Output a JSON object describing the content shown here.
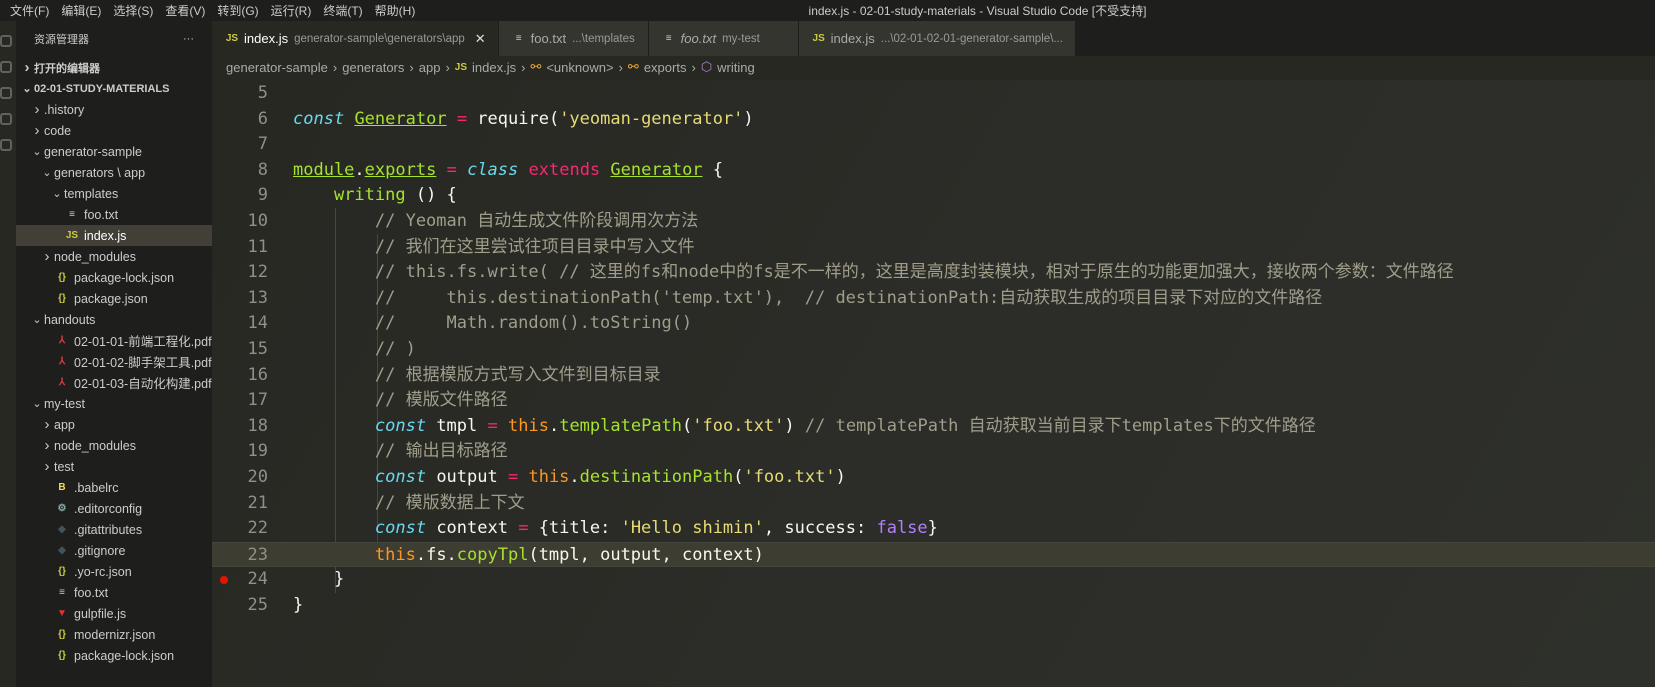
{
  "title": {
    "menus": [
      "文件(F)",
      "编辑(E)",
      "选择(S)",
      "查看(V)",
      "转到(G)",
      "运行(R)",
      "终端(T)",
      "帮助(H)"
    ],
    "window_title": "index.js - 02-01-study-materials - Visual Studio Code [不受支持]"
  },
  "sidebar": {
    "header": "资源管理器",
    "more": "···",
    "rows": [
      {
        "label": "打开的编辑器",
        "depth": 0,
        "chev": "›",
        "sec": true
      },
      {
        "label": "02-01-STUDY-MATERIALS",
        "depth": 0,
        "chev": "⌄",
        "sec": true
      },
      {
        "label": ".history",
        "depth": 1,
        "chev": "›"
      },
      {
        "label": "code",
        "depth": 1,
        "chev": "›"
      },
      {
        "label": "generator-sample",
        "depth": 1,
        "chev": "⌄"
      },
      {
        "label": "generators \\ app",
        "depth": 2,
        "chev": "⌄"
      },
      {
        "label": "templates",
        "depth": 3,
        "chev": "⌄"
      },
      {
        "label": "foo.txt",
        "depth": 3,
        "icon": "txt"
      },
      {
        "label": "index.js",
        "depth": 3,
        "icon": "js",
        "sel": true
      },
      {
        "label": "node_modules",
        "depth": 2,
        "chev": "›"
      },
      {
        "label": "package-lock.json",
        "depth": 2,
        "icon": "json"
      },
      {
        "label": "package.json",
        "depth": 2,
        "icon": "json"
      },
      {
        "label": "handouts",
        "depth": 1,
        "chev": "⌄"
      },
      {
        "label": "02-01-01-前端工程化.pdf",
        "depth": 2,
        "icon": "pdf"
      },
      {
        "label": "02-01-02-脚手架工具.pdf",
        "depth": 2,
        "icon": "pdf"
      },
      {
        "label": "02-01-03-自动化构建.pdf",
        "depth": 2,
        "icon": "pdf"
      },
      {
        "label": "my-test",
        "depth": 1,
        "chev": "⌄"
      },
      {
        "label": "app",
        "depth": 2,
        "chev": "›"
      },
      {
        "label": "node_modules",
        "depth": 2,
        "chev": "›"
      },
      {
        "label": "test",
        "depth": 2,
        "chev": "›"
      },
      {
        "label": ".babelrc",
        "depth": 2,
        "icon": "babel"
      },
      {
        "label": ".editorconfig",
        "depth": 2,
        "icon": "gear"
      },
      {
        "label": ".gitattributes",
        "depth": 2,
        "icon": "git"
      },
      {
        "label": ".gitignore",
        "depth": 2,
        "icon": "git"
      },
      {
        "label": ".yo-rc.json",
        "depth": 2,
        "icon": "json"
      },
      {
        "label": "foo.txt",
        "depth": 2,
        "icon": "txt"
      },
      {
        "label": "gulpfile.js",
        "depth": 2,
        "icon": "gulp"
      },
      {
        "label": "modernizr.json",
        "depth": 2,
        "icon": "json"
      },
      {
        "label": "package-lock.json",
        "depth": 2,
        "icon": "json"
      }
    ]
  },
  "icons": {
    "js": {
      "g": "JS",
      "c": "#cbcb41"
    },
    "json": {
      "g": "{}",
      "c": "#cbcb41"
    },
    "txt": {
      "g": "≡",
      "c": "#ccc"
    },
    "pdf": {
      "g": "⅄",
      "c": "#e03c3c"
    },
    "babel": {
      "g": "B",
      "c": "#f5da55"
    },
    "gear": {
      "g": "⚙",
      "c": "#8aa"
    },
    "git": {
      "g": "◆",
      "c": "#41535b"
    },
    "gulp": {
      "g": "▼",
      "c": "#e0342f"
    }
  },
  "tabs": [
    {
      "icon": "js",
      "label": "index.js",
      "desc": "generator-sample\\generators\\app",
      "close": "✕",
      "active": true
    },
    {
      "icon": "txt",
      "label": "foo.txt",
      "desc": "...\\templates"
    },
    {
      "icon": "txt",
      "label": "foo.txt",
      "desc": "my-test",
      "italic": true
    },
    {
      "icon": "js",
      "label": "index.js",
      "desc": "...\\02-01-02-01-generator-sample\\..."
    }
  ],
  "breadcrumb": [
    "generator-sample",
    "generators",
    "app",
    "index.js",
    "<unknown>",
    "exports",
    "writing"
  ],
  "code": {
    "current_line": 23,
    "breakpoint_line": 24,
    "lines": [
      {
        "n": "5",
        "t": []
      },
      {
        "n": "6",
        "t": [
          [
            "const",
            "kw"
          ],
          [
            " ",
            "pl"
          ],
          [
            "Generator",
            "cls"
          ],
          [
            " ",
            "pl"
          ],
          [
            "=",
            "op"
          ],
          [
            " require(",
            "pl"
          ],
          [
            "'yeoman-generator'",
            "str"
          ],
          [
            ")",
            "pl"
          ]
        ]
      },
      {
        "n": "7",
        "t": []
      },
      {
        "n": "8",
        "t": [
          [
            "module",
            "cls"
          ],
          [
            ".",
            "pl"
          ],
          [
            "exports",
            "cls"
          ],
          [
            " ",
            "pl"
          ],
          [
            "=",
            "op"
          ],
          [
            " ",
            "pl"
          ],
          [
            "class",
            "kw"
          ],
          [
            " ",
            "pl"
          ],
          [
            "extends",
            "op"
          ],
          [
            " ",
            "pl"
          ],
          [
            "Generator",
            "cls"
          ],
          [
            " {",
            "pl"
          ]
        ]
      },
      {
        "n": "9",
        "t": [
          [
            "    ",
            "pl"
          ],
          [
            "writing",
            "fn"
          ],
          [
            " () {",
            "pl"
          ]
        ]
      },
      {
        "n": "10",
        "t": [
          [
            "        // Yeoman 自动生成文件阶段调用次方法",
            "cm"
          ]
        ]
      },
      {
        "n": "11",
        "t": [
          [
            "        // 我们在这里尝试往项目目录中写入文件",
            "cm"
          ]
        ]
      },
      {
        "n": "12",
        "t": [
          [
            "        // this.fs.write( // 这里的fs和node中的fs是不一样的，这里是高度封装模块，相对于原生的功能更加强大，接收两个参数：文件路径",
            "cm"
          ]
        ]
      },
      {
        "n": "13",
        "t": [
          [
            "        //     this.destinationPath('temp.txt'),  // destinationPath:自动获取生成的项目目录下对应的文件路径",
            "cm"
          ]
        ]
      },
      {
        "n": "14",
        "t": [
          [
            "        //     Math.random().toString()",
            "cm"
          ]
        ]
      },
      {
        "n": "15",
        "t": [
          [
            "        // )",
            "cm"
          ]
        ]
      },
      {
        "n": "16",
        "t": [
          [
            "        // 根据模版方式写入文件到目标目录",
            "cm"
          ]
        ]
      },
      {
        "n": "17",
        "t": [
          [
            "        // 模版文件路径",
            "cm"
          ]
        ]
      },
      {
        "n": "18",
        "t": [
          [
            "        ",
            "pl"
          ],
          [
            "const",
            "kw"
          ],
          [
            " tmpl ",
            "pl"
          ],
          [
            "=",
            "op"
          ],
          [
            " ",
            "pl"
          ],
          [
            "this",
            "th"
          ],
          [
            ".",
            "pl"
          ],
          [
            "templatePath",
            "fn"
          ],
          [
            "(",
            "pl"
          ],
          [
            "'foo.txt'",
            "str"
          ],
          [
            ") ",
            "pl"
          ],
          [
            "// templatePath 自动获取当前目录下templates下的文件路径",
            "cm"
          ]
        ]
      },
      {
        "n": "19",
        "t": [
          [
            "        // 输出目标路径",
            "cm"
          ]
        ]
      },
      {
        "n": "20",
        "t": [
          [
            "        ",
            "pl"
          ],
          [
            "const",
            "kw"
          ],
          [
            " output ",
            "pl"
          ],
          [
            "=",
            "op"
          ],
          [
            " ",
            "pl"
          ],
          [
            "this",
            "th"
          ],
          [
            ".",
            "pl"
          ],
          [
            "destinationPath",
            "fn"
          ],
          [
            "(",
            "pl"
          ],
          [
            "'foo.txt'",
            "str"
          ],
          [
            ")",
            "pl"
          ]
        ]
      },
      {
        "n": "21",
        "t": [
          [
            "        // 模版数据上下文",
            "cm"
          ]
        ]
      },
      {
        "n": "22",
        "t": [
          [
            "        ",
            "pl"
          ],
          [
            "const",
            "kw"
          ],
          [
            " context ",
            "pl"
          ],
          [
            "=",
            "op"
          ],
          [
            " {title: ",
            "pl"
          ],
          [
            "'Hello shimin'",
            "str"
          ],
          [
            ", success: ",
            "pl"
          ],
          [
            "false",
            "bool"
          ],
          [
            "}",
            "pl"
          ]
        ]
      },
      {
        "n": "23",
        "t": [
          [
            "        ",
            "pl"
          ],
          [
            "this",
            "th"
          ],
          [
            ".fs.",
            "pl"
          ],
          [
            "copyTpl",
            "fn"
          ],
          [
            "(tmpl, output, context)",
            "pl"
          ]
        ]
      },
      {
        "n": "24",
        "t": [
          [
            "    }",
            "pl"
          ]
        ]
      },
      {
        "n": "25",
        "t": [
          [
            "}",
            "pl"
          ]
        ]
      }
    ]
  }
}
